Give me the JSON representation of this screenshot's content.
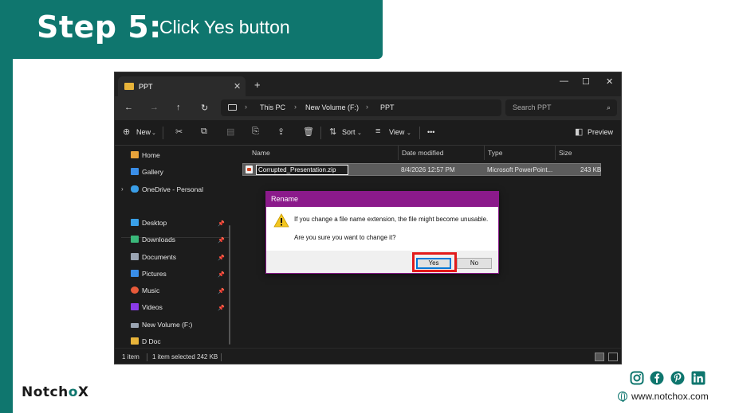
{
  "banner": {
    "step": "Step 5:",
    "instruction": "Click Yes button"
  },
  "explorer": {
    "tab_title": "PPT",
    "new_tab": "+",
    "controls": {
      "minimize": "—",
      "maximize": "☐",
      "close": "✕",
      "tab_close": "✕"
    },
    "nav": {
      "back": "←",
      "forward": "→",
      "up": "↑",
      "refresh": "↻"
    },
    "breadcrumbs": [
      "This PC",
      "New Volume (F:)",
      "PPT"
    ],
    "breadcrumb_sep": "›",
    "search_placeholder": "Search PPT",
    "toolbar": {
      "new": "New",
      "sort": "Sort",
      "view": "View",
      "more": "•••",
      "preview": "Preview"
    },
    "sidebar": {
      "top": [
        {
          "label": "Home",
          "icon": "home-icon",
          "color": "#e8a33a"
        },
        {
          "label": "Gallery",
          "icon": "gallery-icon",
          "color": "#3a8ee8"
        },
        {
          "label": "OneDrive - Personal",
          "icon": "onedrive-icon",
          "color": "#3a9ee8"
        }
      ],
      "pinned": [
        {
          "label": "Desktop",
          "icon": "desktop-icon",
          "color": "#3aa0e8"
        },
        {
          "label": "Downloads",
          "icon": "downloads-icon",
          "color": "#3ab87a"
        },
        {
          "label": "Documents",
          "icon": "documents-icon",
          "color": "#9aa4b2"
        },
        {
          "label": "Pictures",
          "icon": "pictures-icon",
          "color": "#3a8ee8"
        },
        {
          "label": "Music",
          "icon": "music-icon",
          "color": "#e85a3a"
        },
        {
          "label": "Videos",
          "icon": "videos-icon",
          "color": "#8a3ae8"
        }
      ],
      "drives": [
        {
          "label": "New Volume (F:)",
          "icon": "drive-icon",
          "color": "#9aa4b2"
        },
        {
          "label": "D Doc",
          "icon": "folder-icon",
          "color": "#e8b43a"
        }
      ]
    },
    "columns": [
      "Name",
      "Date modified",
      "Type",
      "Size"
    ],
    "file": {
      "name": "Corrupted_Presentation.zip",
      "date": "8/4/2026 12:57 PM",
      "type": "Microsoft PowerPoint...",
      "size": "243 KB"
    },
    "status": {
      "items": "1 item",
      "selected": "1 item selected  242 KB"
    }
  },
  "dialog": {
    "title": "Rename",
    "message_line1": "If you change a file name extension, the file might become unusable.",
    "message_line2": "Are you sure you want to change it?",
    "yes_label": "Yes",
    "no_label": "No",
    "accent": "#8b1a8b"
  },
  "highlight_color": "#e21b1b",
  "footer": {
    "logo_main": "Notch",
    "logo_accent": "o",
    "logo_end": "X",
    "website": "www.notchox.com",
    "social_icons": [
      "instagram-icon",
      "facebook-icon",
      "pinterest-icon",
      "linkedin-icon"
    ]
  }
}
